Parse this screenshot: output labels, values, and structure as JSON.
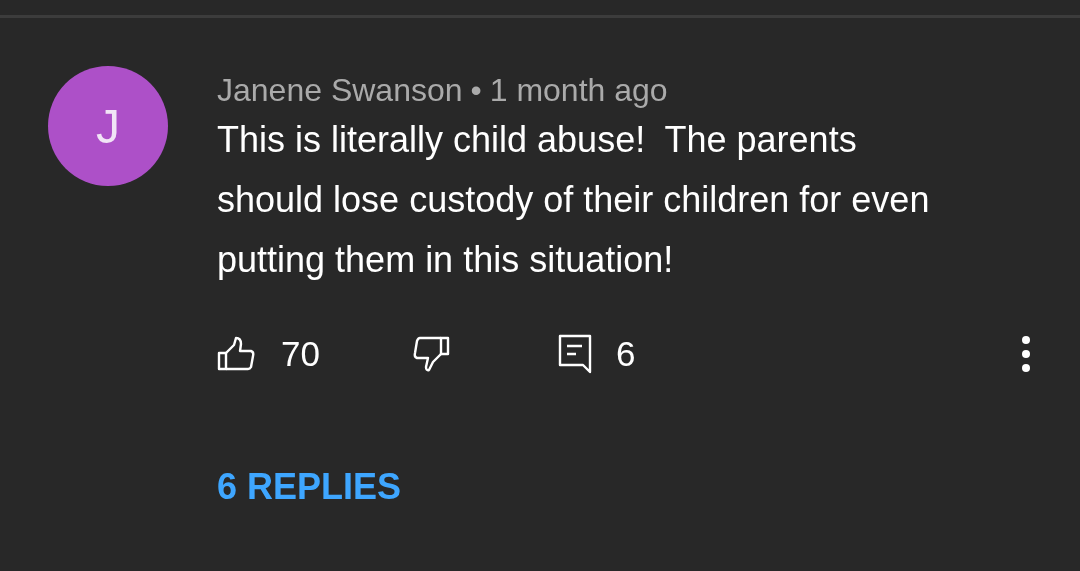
{
  "comment": {
    "avatar_initial": "J",
    "author": "Janene Swanson",
    "separator": "•",
    "time": "1 month ago",
    "text": "This is literally child abuse!  The parents should lose custody of their children for even putting them in this situation!",
    "likes": "70",
    "reply_count": "6",
    "replies_link": "6 REPLIES"
  }
}
